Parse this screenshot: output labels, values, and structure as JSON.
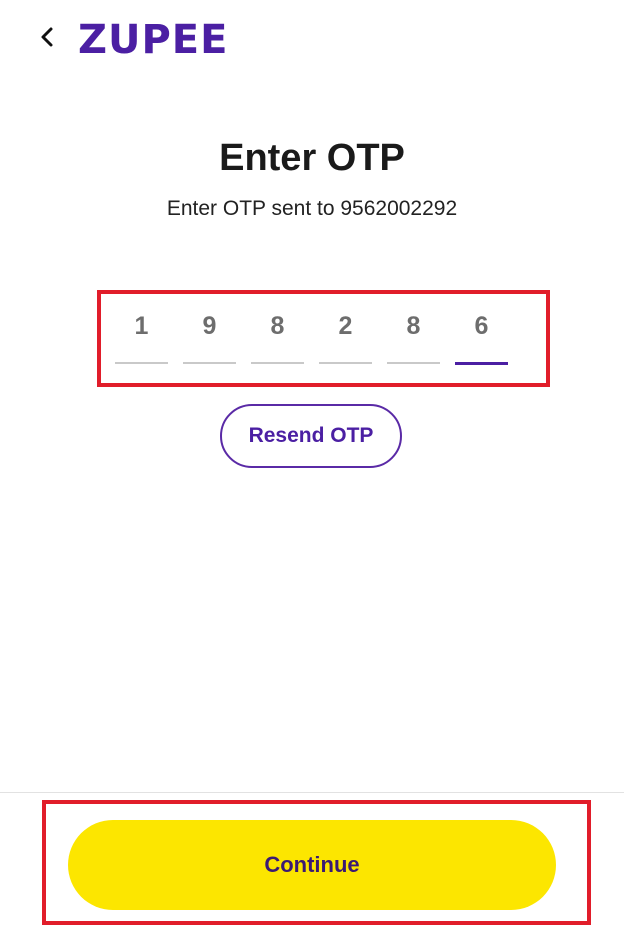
{
  "header": {
    "back_icon": "chevron-left-icon",
    "logo_text": "ZUPEE",
    "brand_color": "#4b1fa3"
  },
  "main": {
    "title": "Enter OTP",
    "subtitle": "Enter OTP sent to 9562002292",
    "otp_digits": [
      "1",
      "9",
      "8",
      "2",
      "8",
      "6"
    ],
    "active_digit_index": 5,
    "resend_label": "Resend OTP"
  },
  "footer": {
    "continue_label": "Continue",
    "continue_color": "#fce600"
  },
  "highlight_color": "#e11d2a"
}
